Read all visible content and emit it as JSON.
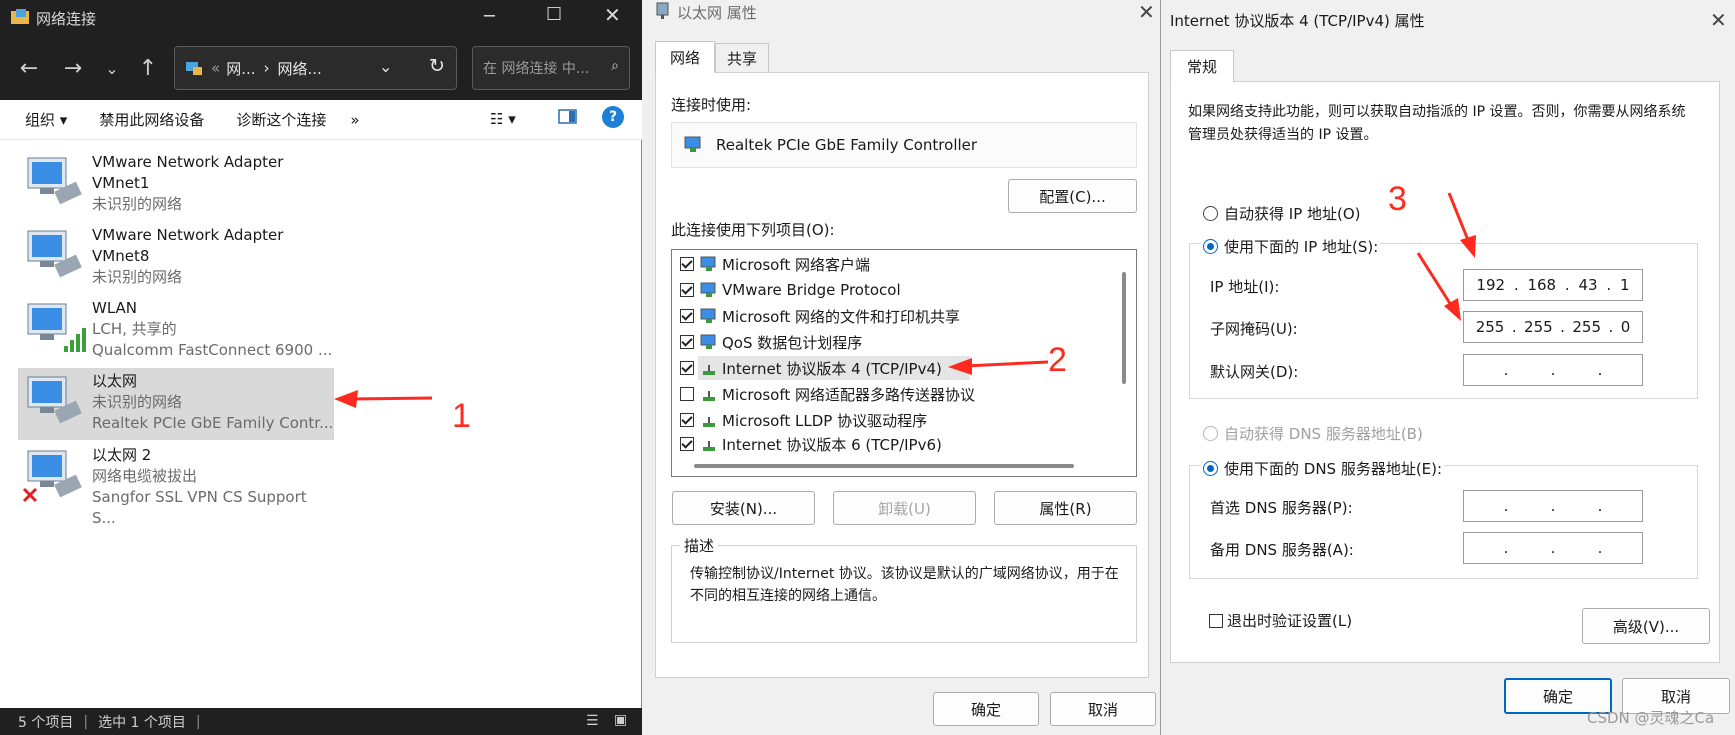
{
  "explorer": {
    "title": "网络连接",
    "breadcrumb": [
      "网...",
      "网络..."
    ],
    "search_placeholder": "在 网络连接 中...",
    "commands": [
      "组织 ▾",
      "禁用此网络设备",
      "诊断这个连接",
      "»"
    ],
    "adapters": [
      {
        "name": "VMware Network Adapter",
        "name2": "VMnet1",
        "status": "未识别的网络",
        "device": ""
      },
      {
        "name": "VMware Network Adapter",
        "name2": "VMnet8",
        "status": "未识别的网络",
        "device": ""
      },
      {
        "name": "WLAN",
        "name2": "",
        "status": "LCH, 共享的",
        "device": "Qualcomm FastConnect 6900 ..."
      },
      {
        "name": "以太网",
        "name2": "",
        "status": "未识别的网络",
        "device": "Realtek PCIe GbE Family Contr..."
      },
      {
        "name": "以太网 2",
        "name2": "",
        "status": "网络电缆被拔出",
        "device": "Sangfor SSL VPN CS Support S..."
      }
    ],
    "status_items": "5 个项目",
    "status_selected": "选中 1 个项目"
  },
  "eth_dialog": {
    "title": "以太网 属性",
    "tabs": [
      "网络",
      "共享"
    ],
    "connect_using_label": "连接时使用:",
    "adapter_name": "Realtek PCIe GbE Family Controller",
    "configure_button": "配置(C)...",
    "items_label": "此连接使用下列项目(O):",
    "items": [
      {
        "label": "Microsoft 网络客户端",
        "checked": true
      },
      {
        "label": "VMware Bridge Protocol",
        "checked": true
      },
      {
        "label": "Microsoft 网络的文件和打印机共享",
        "checked": true
      },
      {
        "label": "QoS 数据包计划程序",
        "checked": true
      },
      {
        "label": "Internet 协议版本 4 (TCP/IPv4)",
        "checked": true
      },
      {
        "label": "Microsoft 网络适配器多路传送器协议",
        "checked": false
      },
      {
        "label": "Microsoft LLDP 协议驱动程序",
        "checked": true
      },
      {
        "label": "Internet 协议版本 6 (TCP/IPv6)",
        "checked": true
      }
    ],
    "install_button": "安装(N)...",
    "uninstall_button": "卸载(U)",
    "properties_button": "属性(R)",
    "description_label": "描述",
    "description_text": "传输控制协议/Internet 协议。该协议是默认的广域网络协议，用于在不同的相互连接的网络上通信。",
    "ok_button": "确定",
    "cancel_button": "取消"
  },
  "ipv4_dialog": {
    "title": "Internet 协议版本 4 (TCP/IPv4) 属性",
    "tab": "常规",
    "intro": "如果网络支持此功能，则可以获取自动指派的 IP 设置。否则，你需要从网络系统管理员处获得适当的 IP 设置。",
    "auto_ip": "自动获得 IP 地址(O)",
    "manual_ip": "使用下面的 IP 地址(S):",
    "ip_label": "IP 地址(I):",
    "ip_value": [
      "192",
      "168",
      "43",
      "1"
    ],
    "mask_label": "子网掩码(U):",
    "mask_value": [
      "255",
      "255",
      "255",
      "0"
    ],
    "gateway_label": "默认网关(D):",
    "auto_dns": "自动获得 DNS 服务器地址(B)",
    "manual_dns": "使用下面的 DNS 服务器地址(E):",
    "dns1_label": "首选 DNS 服务器(P):",
    "dns2_label": "备用 DNS 服务器(A):",
    "validate_label": "退出时验证设置(L)",
    "advanced_button": "高级(V)...",
    "ok_button": "确定",
    "cancel_button": "取消"
  },
  "annotations": [
    "1",
    "2",
    "3"
  ],
  "watermark": "CSDN @灵魂之Ca"
}
